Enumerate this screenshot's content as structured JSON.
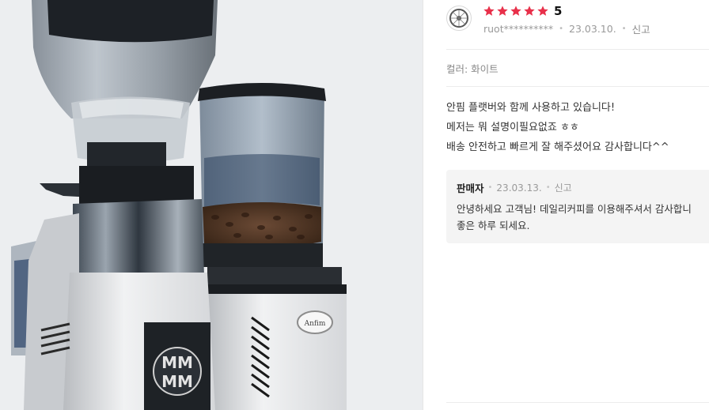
{
  "review": {
    "rating": "5",
    "star_count": 5,
    "star_color": "#e8304a",
    "author": "ruot**********",
    "date": "23.03.10.",
    "report_label": "신고",
    "option": "컬러: 화이트",
    "body_lines": [
      "안핌 플랫버와 함께 사용하고 있습니다!",
      "메저는 뭐 설명이필요없죠 ㅎㅎ",
      "배송 안전하고 빠르게 잘 해주셨어요 감사합니다^^"
    ]
  },
  "reply": {
    "author": "판매자",
    "date": "23.03.13.",
    "report_label": "신고",
    "body_lines": [
      "안녕하세요 고객님! 데일리커피를 이용해주셔서 감사합니",
      "좋은 하루 되세요."
    ]
  },
  "photo": {
    "grinder_logo": "MM",
    "badge_text": "Anfim"
  }
}
